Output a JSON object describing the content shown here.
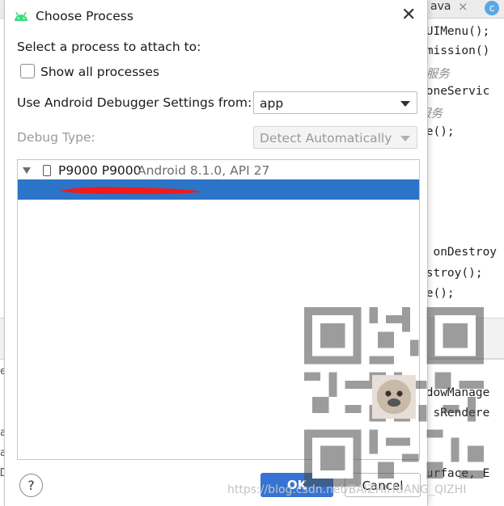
{
  "ide": {
    "tab_title": "ava",
    "tab_close": "×",
    "tab_badge": "c",
    "code_lines": [
      {
        "text": "mUIMenu();",
        "type": "code"
      },
      {
        "text": "rmission()",
        "type": "code"
      },
      {
        "text": "e服务",
        "type": "comment"
      },
      {
        "text": "honeServic",
        "type": "code"
      },
      {
        "text": "服务",
        "type": "comment"
      },
      {
        "text": "te();",
        "type": "code"
      },
      {
        "text": "d onDestroy",
        "type": "code"
      },
      {
        "text": "estroy();",
        "type": "code"
      },
      {
        "text": "te();",
        "type": "code"
      },
      {
        "text": "ndowManage",
        "type": "code"
      },
      {
        "text": ", sRendere",
        "type": "code"
      },
      {
        "text": "Surface, E",
        "type": "code"
      }
    ],
    "gutter_letters": [
      "e",
      "a",
      "a",
      "D"
    ]
  },
  "dialog": {
    "title": "Choose Process",
    "close_glyph": "✕",
    "prompt": "Select a process to attach to:",
    "show_all_label": "Show all processes",
    "show_all_checked": false,
    "debugger_settings_label": "Use Android Debugger Settings from:",
    "debugger_settings_value": "app",
    "debug_type_label": "Debug Type:",
    "debug_type_value": "Detect Automatically",
    "device": {
      "name": "P9000 P9000",
      "details": "Android 8.1.0, API 27"
    },
    "help_glyph": "?",
    "ok_label": "OK",
    "cancel_label": "Cancel"
  },
  "colors": {
    "selection": "#2b74c7",
    "android_green": "#3ddc84",
    "ok_button": "#3574d4"
  },
  "watermark": "https://blog.csdn.net/BAIZHIHUANG_QIZHI"
}
